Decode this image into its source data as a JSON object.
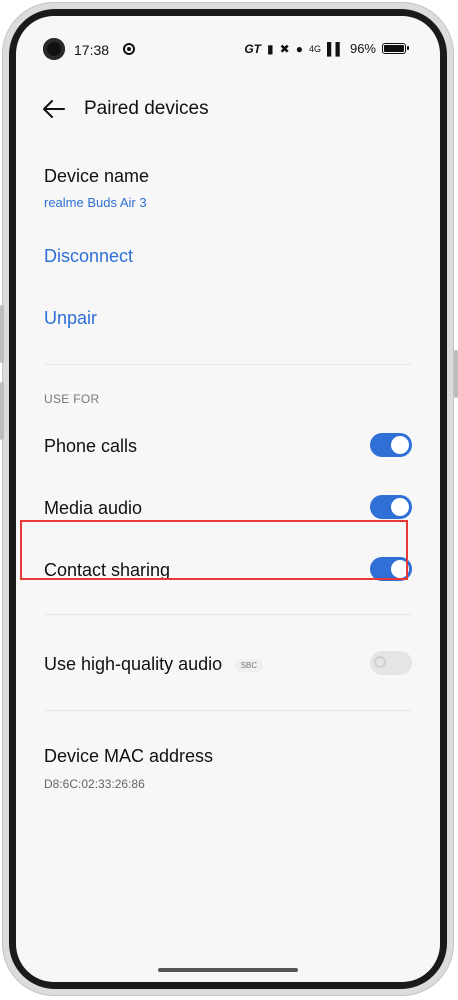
{
  "statusbar": {
    "time": "17:38",
    "battery_label": "96%",
    "signal_label": "4G",
    "icons": [
      "chrome-icon",
      "gt-icon",
      "vibrate-icon",
      "bluetooth-icon",
      "location-icon",
      "signal-icon",
      "battery-icon"
    ]
  },
  "header": {
    "title": "Paired devices",
    "back_icon": "back-arrow-icon"
  },
  "device": {
    "name_label": "Device name",
    "name_value": "realme Buds Air 3"
  },
  "actions": {
    "disconnect": "Disconnect",
    "unpair": "Unpair"
  },
  "use_for": {
    "section_label": "USE FOR",
    "items": [
      {
        "label": "Phone calls",
        "on": true
      },
      {
        "label": "Media audio",
        "on": true
      },
      {
        "label": "Contact sharing",
        "on": true
      }
    ]
  },
  "hq_audio": {
    "label": "Use high-quality audio",
    "badge": "SBC",
    "on": false
  },
  "mac": {
    "label": "Device MAC address",
    "value": "D8:6C:02:33:26:86"
  },
  "colors": {
    "accent": "#2f6fd6",
    "highlight": "#e53935",
    "background": "#f7f7f7"
  }
}
